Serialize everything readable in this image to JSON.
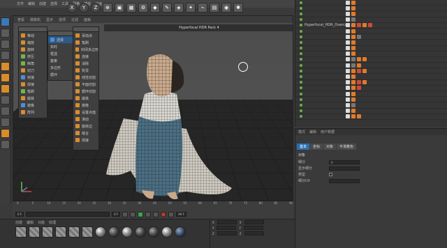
{
  "viewport": {
    "title": "Hyperfocal HDR Pack 4"
  },
  "objects": [
    {
      "name": "",
      "selected": false
    },
    {
      "name": "",
      "selected": false
    },
    {
      "name": "",
      "selected": false
    },
    {
      "name": "",
      "selected": false
    },
    {
      "name": "Hyperfocal_HDR_Overcast",
      "selected": false
    },
    {
      "name": "",
      "selected": false
    },
    {
      "name": "",
      "selected": false
    },
    {
      "name": "",
      "selected": false
    },
    {
      "name": "",
      "selected": false
    },
    {
      "name": "",
      "selected": false
    },
    {
      "name": "",
      "selected": false
    },
    {
      "name": "",
      "selected": false
    },
    {
      "name": "",
      "selected": false
    },
    {
      "name": "",
      "selected": false
    },
    {
      "name": "",
      "selected": false
    },
    {
      "name": "",
      "selected": false
    },
    {
      "name": "",
      "selected": false
    },
    {
      "name": "",
      "selected": false
    },
    {
      "name": "",
      "selected": false
    },
    {
      "name": "",
      "selected": false
    },
    {
      "name": "",
      "selected": false
    }
  ],
  "timeline": {
    "ticks": [
      "0",
      "5",
      "10",
      "15",
      "20",
      "25",
      "30",
      "35",
      "40",
      "45",
      "50",
      "55",
      "60",
      "65",
      "70",
      "75",
      "80",
      "85",
      "90"
    ],
    "current_frame": "0 F",
    "start": "0 F",
    "end": "90 F"
  },
  "attr_fields": [
    {
      "value": "0"
    },
    {
      "value": ""
    },
    {
      "value": ""
    },
    {
      "value": ""
    }
  ],
  "coords": {
    "rows": [
      "X",
      "Y",
      "Z"
    ]
  }
}
